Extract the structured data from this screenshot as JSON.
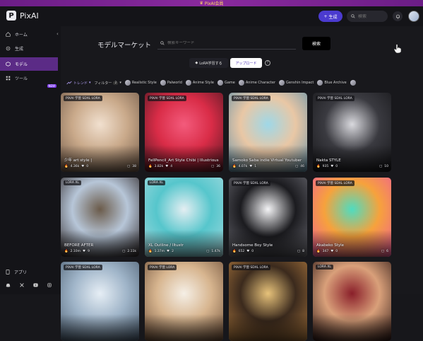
{
  "banner": {
    "text": "PixAI会員"
  },
  "header": {
    "brand": "PixAI",
    "generate_label": "生成",
    "search_placeholder": "検索"
  },
  "sidebar": {
    "items": [
      {
        "label": "ホーム",
        "icon": "home-icon"
      },
      {
        "label": "生成",
        "icon": "wand-icon"
      },
      {
        "label": "モデル",
        "icon": "model-icon",
        "active": true
      },
      {
        "label": "ツール",
        "icon": "tools-icon",
        "badge": "NEW"
      }
    ],
    "app_label": "アプリ",
    "social": [
      "discord-icon",
      "x-icon",
      "youtube-icon",
      "instagram-icon"
    ]
  },
  "main": {
    "title": "モデルマーケット",
    "keyword_placeholder": "検索キーワード",
    "search_button": "検索",
    "learn_lora_label": "LoRA学習する",
    "upload_label": "アップロード",
    "filters": {
      "sort_label": "トレンド",
      "filter_label": "フィルター",
      "filter_count": "2",
      "categories": [
        "Realistic Style",
        "Palworld",
        "Anime Style",
        "Game",
        "Anime Character",
        "Genshin Impact",
        "Blue Archive"
      ]
    }
  },
  "cards": [
    {
      "badge": "PIXAI 学習 SDXL LORA",
      "title": "少年 art style |",
      "runs": "4.36k",
      "likes": "0",
      "comments": "38",
      "colors": [
        "#f1e0cf",
        "#c9a98a",
        "#6e5746"
      ]
    },
    {
      "badge": "PIXAI 学習 SDXL LORA",
      "title": "FellPencil_Art Style Chibi | Illustrious-XL v1.0",
      "runs": "3.82k",
      "likes": "4",
      "comments": "36",
      "colors": [
        "#f35b7c",
        "#d92c47",
        "#4a1720"
      ]
    },
    {
      "badge": "PIXAI 学習 SDXL LORA",
      "title": "Samoko Saba indie Virtual Youtuber",
      "runs": "4.07k",
      "likes": "1",
      "comments": "46",
      "colors": [
        "#9fd8e8",
        "#e9c7a5",
        "#5d8ea8"
      ]
    },
    {
      "badge": "PIXAI 学習 SDXL LORA",
      "title": "Nakta STYLE",
      "runs": "935",
      "likes": "0",
      "comments": "10",
      "colors": [
        "#d9d9de",
        "#3a3a40",
        "#151518"
      ]
    },
    {
      "badge": "LORA XL",
      "title": "BEFORE  AFTER",
      "runs": "2.10m",
      "likes": "9",
      "comments": "2.11k",
      "colors": [
        "#6b5b4a",
        "#b7c6d8",
        "#2a2222"
      ]
    },
    {
      "badge": "LORA XL",
      "title": "XL Outline / Iltustr",
      "runs": "1.37m",
      "likes": "2",
      "comments": "1.47k",
      "colors": [
        "#e4eef2",
        "#56c6cc",
        "#a7dbe0"
      ]
    },
    {
      "badge": "PIXAI 学習 SDXL LORA",
      "title": "Handsome Boy Style",
      "runs": "652",
      "likes": "0",
      "comments": "8",
      "colors": [
        "#f4f4f6",
        "#1b1b1f",
        "#6c6c74"
      ]
    },
    {
      "badge": "PIXAI 学習 SDXL LORA",
      "title": "Akabeko Style",
      "runs": "347",
      "likes": "0",
      "comments": "6",
      "colors": [
        "#4fdcc0",
        "#f6a23c",
        "#f05a9c"
      ]
    },
    {
      "badge": "PIXAI 学習 SDXL LORA",
      "title": "",
      "runs": "",
      "likes": "",
      "comments": "",
      "colors": [
        "#e6eef5",
        "#9fb4c8",
        "#4b5d70"
      ]
    },
    {
      "badge": "PIXAI 学習 LORA",
      "title": "",
      "runs": "",
      "likes": "",
      "comments": "",
      "colors": [
        "#f5efe6",
        "#d7b58f",
        "#6b4c36"
      ]
    },
    {
      "badge": "PIXAI 学習 SDXL LORA",
      "title": "",
      "runs": "",
      "likes": "",
      "comments": "",
      "colors": [
        "#e7c27a",
        "#3b2a1d",
        "#b07a3f"
      ]
    },
    {
      "badge": "LORA XL",
      "title": "",
      "runs": "",
      "likes": "",
      "comments": "",
      "colors": [
        "#8a1f2a",
        "#d9a07a",
        "#2b1614"
      ]
    }
  ]
}
